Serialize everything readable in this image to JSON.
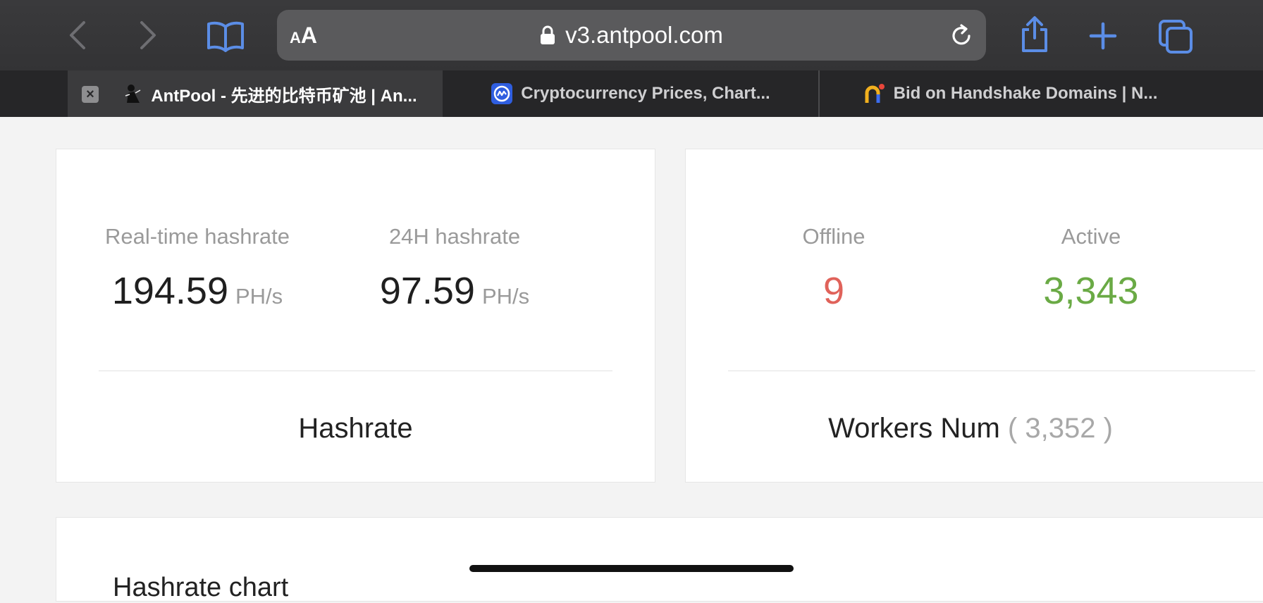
{
  "browser": {
    "reader_small": "A",
    "reader_big": "A",
    "url": "v3.antpool.com"
  },
  "tabs": [
    {
      "title": "AntPool - 先进的比特币矿池 | An...",
      "active": true
    },
    {
      "title": "Cryptocurrency Prices, Chart...",
      "active": false
    },
    {
      "title": "Bid on Handshake Domains | N...",
      "active": false
    }
  ],
  "hashrate_card": {
    "realtime_label": "Real-time hashrate",
    "realtime_value": "194.59",
    "realtime_unit": "PH/s",
    "h24_label": "24H hashrate",
    "h24_value": "97.59",
    "h24_unit": "PH/s",
    "footer": "Hashrate"
  },
  "workers_card": {
    "offline_label": "Offline",
    "offline_value": "9",
    "active_label": "Active",
    "active_value": "3,343",
    "footer": "Workers Num",
    "paren_open": "(",
    "total": "3,352",
    "paren_close": ")"
  },
  "chart_section": {
    "title": "Hashrate chart"
  },
  "colors": {
    "accent_blue": "#5b8de6",
    "offline_red": "#e0625a",
    "active_green": "#6aaa45"
  }
}
